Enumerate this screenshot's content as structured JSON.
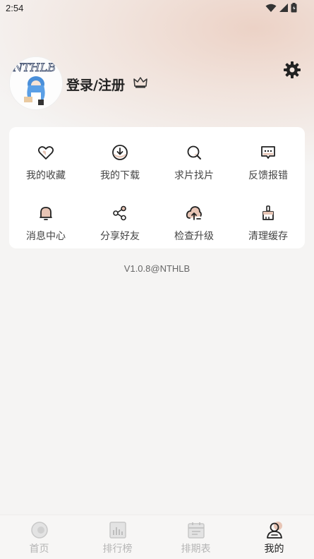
{
  "status_bar": {
    "time": "2:54",
    "icons": [
      "wifi-icon",
      "signal-icon",
      "battery-icon"
    ]
  },
  "profile": {
    "login_label": "登录/注册",
    "avatar_text": "NTHLB",
    "crown_icon": "crown-icon",
    "settings_icon": "gear-icon"
  },
  "menu": [
    {
      "label": "我的收藏",
      "icon": "heart-icon"
    },
    {
      "label": "我的下载",
      "icon": "download-icon"
    },
    {
      "label": "求片找片",
      "icon": "search-icon"
    },
    {
      "label": "反馈报错",
      "icon": "feedback-icon"
    },
    {
      "label": "消息中心",
      "icon": "bell-icon"
    },
    {
      "label": "分享好友",
      "icon": "share-icon"
    },
    {
      "label": "检查升级",
      "icon": "upgrade-icon"
    },
    {
      "label": "清理缓存",
      "icon": "broom-icon"
    }
  ],
  "version": "V1.0.8@NTHLB",
  "bottom_nav": [
    {
      "label": "首页",
      "icon": "home-icon",
      "active": false
    },
    {
      "label": "排行榜",
      "icon": "chart-icon",
      "active": false
    },
    {
      "label": "排期表",
      "icon": "calendar-icon",
      "active": false
    },
    {
      "label": "我的",
      "icon": "profile-icon",
      "active": true
    }
  ],
  "colors": {
    "accent": "#e8c5b5",
    "text": "#222222",
    "inactive": "#b5b5b5"
  }
}
